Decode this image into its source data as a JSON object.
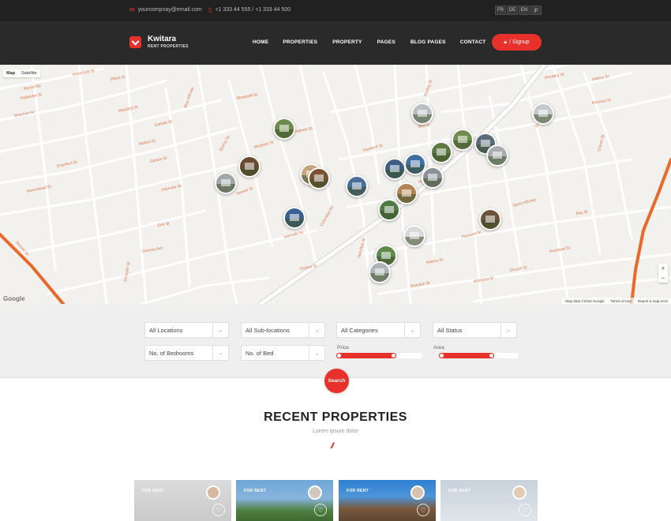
{
  "topbar": {
    "email": "yourcompnay@email.com",
    "phone": "+1 333 44 555  /  +1 333 44 500",
    "email_icon": "envelope-icon",
    "phone_icon": "phone-icon",
    "languages": [
      "FR",
      "DE",
      "EN",
      "jp"
    ]
  },
  "brand": {
    "name": "Kwitara",
    "tagline": "RENT PROPERTIES",
    "icon": "shield-logo-icon"
  },
  "nav": {
    "items": [
      "HOME",
      "PROPERTIES",
      "PROPERTY",
      "PAGES",
      "BLOG PAGES",
      "CONTACT"
    ],
    "signup_label": "/ Signup",
    "signup_icon": "lock-icon"
  },
  "map": {
    "type_map": "Map",
    "type_satellite": "Satellite",
    "google_logo": "Google",
    "footer": [
      "Map data ©2016 Google",
      "Terms of Use",
      "Report a map error"
    ],
    "zoom_in": "+",
    "zoom_out": "−",
    "streets": [
      "Haverlock St",
      "Elbert St",
      "Ranch Rd",
      "Hollander St",
      "Waymart St",
      "Stevens St",
      "Walton St",
      "Carlisle St",
      "Gaston St",
      "Crawford St",
      "Elm Hill Ave",
      "Homestead St",
      "Humboldt Ave",
      "Wayland St",
      "Woodcliff St",
      "Quincy St",
      "Blue Hill Ave",
      "Cunningham St",
      "Supple Rd",
      "Laurel St",
      "Harold St",
      "Glenway St",
      "Seaver St",
      "Columbia Rd",
      "Erie St",
      "Hamilton St",
      "Washington St",
      "Geneva Ave",
      "Intervale St",
      "Sayward St",
      "Hancock St",
      "Bowdoin St",
      "Church St",
      "Adams St",
      "Dudley St",
      "Bird St",
      "Hinckley St",
      "Marlow St",
      "Romsey St",
      "Chamberlain St",
      "Dorchester Ave",
      "Bay St",
      "Parkman St",
      "Ashmont St",
      "Grover St",
      "Savin Hill Ave",
      "Auckland St",
      "Pleasant St",
      "Stanton St",
      "Schuyler St",
      "Tonawanda St",
      "Dennison St",
      "Ceylon St",
      "Pearl St"
    ]
  },
  "search": {
    "location": "All Locations",
    "sublocation": "All Sub-locations",
    "category": "All Categories",
    "status": "All Status",
    "bedrooms": "No. of Bedrooms",
    "beds": "No. of Bed",
    "price_label": "Price",
    "area_label": "Area",
    "price_range": [
      0,
      0.7
    ],
    "area_range": [
      0,
      0.7
    ],
    "button": "Search"
  },
  "recent": {
    "title": "RECENT PROPERTIES",
    "subtitle": "Lorem ipsum dolor",
    "cards": [
      {
        "badge": "FOR RENT"
      },
      {
        "badge": "FOR RENT"
      },
      {
        "badge": "FOR RENT"
      },
      {
        "badge": "FOR RENT"
      }
    ],
    "favorite_icon": "heart-icon"
  },
  "colors": {
    "accent": "#e8312b",
    "dark": "#2a2a2a",
    "topbar": "#212121",
    "road_label": "#e8734a"
  }
}
